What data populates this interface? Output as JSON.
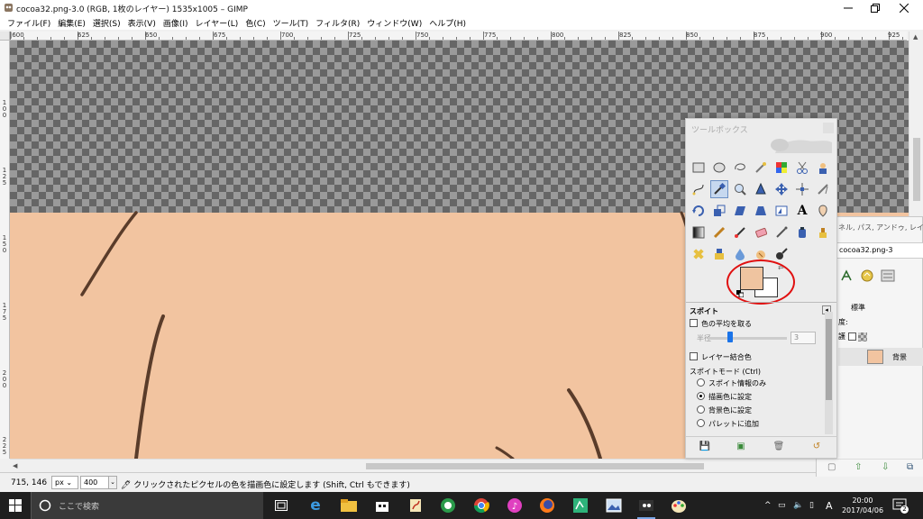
{
  "window": {
    "title": "cocoa32.png-3.0 (RGB, 1枚のレイヤー) 1535x1005 – GIMP"
  },
  "menu": [
    {
      "label": "ファイル(F)"
    },
    {
      "label": "編集(E)"
    },
    {
      "label": "選択(S)"
    },
    {
      "label": "表示(V)"
    },
    {
      "label": "画像(I)"
    },
    {
      "label": "レイヤー(L)"
    },
    {
      "label": "色(C)"
    },
    {
      "label": "ツール(T)"
    },
    {
      "label": "フィルタ(R)"
    },
    {
      "label": "ウィンドウ(W)"
    },
    {
      "label": "ヘルプ(H)"
    }
  ],
  "ruler": {
    "h_labels": [
      "|600",
      "625",
      "650",
      "675",
      "700",
      "725",
      "750",
      "775",
      "800",
      "825",
      "850",
      "875",
      "900",
      "925"
    ],
    "v_labels": [
      "1\n0\n0",
      "1\n2\n5",
      "1\n5\n0",
      "1\n7\n5",
      "2\n0\n0",
      "2\n2\n5"
    ]
  },
  "statusbar": {
    "coords": "715, 146",
    "unit": "px",
    "zoom": "400",
    "message": "クリックされたピクセルの色を描画色に設定します (Shift, Ctrl もできます)"
  },
  "toolbox": {
    "title": "ツールボックス",
    "fg_color": "#efc4a0",
    "bg_color": "#ffffff",
    "options": {
      "title": "スポイト",
      "sample_average": "色の平均を取る",
      "radius_label": "半径",
      "radius_value": "3",
      "sample_merged": "レイヤー結合色",
      "mode_label": "スポイトモード (Ctrl)",
      "modes": [
        {
          "label": "スポイト情報のみ",
          "selected": false
        },
        {
          "label": "描画色に設定",
          "selected": true
        },
        {
          "label": "背景色に設定",
          "selected": false
        },
        {
          "label": "パレットに追加",
          "selected": false
        }
      ]
    }
  },
  "layers": {
    "tab_title": "ネル, パス, アンドゥ, レイヤー",
    "image_name": "cocoa32.png-3",
    "mode": "標準",
    "opacity_label": "度:",
    "lock_label": "護",
    "layer_name": "背景"
  },
  "taskbar": {
    "search_placeholder": "ここで検索",
    "time": "20:00",
    "date": "2017/04/06",
    "ime": "A",
    "notification_count": "2"
  },
  "colors": {
    "skin": "#f2c4a0",
    "accent": "#1a73e8",
    "annotation": "#e01010"
  }
}
